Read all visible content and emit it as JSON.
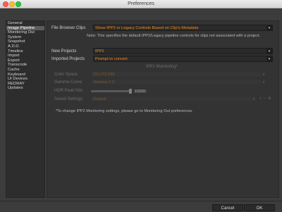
{
  "window": {
    "title": "Preferences"
  },
  "sidebar": {
    "items": [
      {
        "label": "General",
        "selected": false
      },
      {
        "label": "Image Pipeline",
        "selected": true
      },
      {
        "label": "Monitoring Out",
        "selected": false
      },
      {
        "label": "System",
        "selected": false
      },
      {
        "label": "Snapshot",
        "selected": false
      },
      {
        "label": "A.D.D.",
        "selected": false
      },
      {
        "label": "Timeline",
        "selected": false
      },
      {
        "label": "Import",
        "selected": false
      },
      {
        "label": "Export",
        "selected": false
      },
      {
        "label": "Transcode",
        "selected": false
      },
      {
        "label": "Cache",
        "selected": false
      },
      {
        "label": "Keyboard",
        "selected": false
      },
      {
        "label": "UI Devices",
        "selected": false
      },
      {
        "label": "REDRAY",
        "selected": false
      },
      {
        "label": "Updates",
        "selected": false
      }
    ]
  },
  "file_browser_clips": {
    "label": "File Browser Clips",
    "value": "Show IPP2 or Legacy Controls Based on Clip's Metadata",
    "note": "Note: This specifies the default IPP2/Legacy pipeline controls for clips not associated with a project."
  },
  "new_projects": {
    "label": "New Projects",
    "value": "IPP2"
  },
  "imported_projects": {
    "label": "Imported Projects",
    "value": "Prompt to convert"
  },
  "ipp2_monitoring": {
    "heading": "IPP2 Monitoring*",
    "color_space": {
      "label": "Color Space",
      "value": "DCI-P3 D65"
    },
    "gamma_curve": {
      "label": "Gamma Curve",
      "value": "Gamma 2.2"
    },
    "hdr_peak_nits": {
      "label": "HDR Peak Nits",
      "value": "10000",
      "fill": 1.0
    },
    "saved_settings": {
      "label": "Saved Settings",
      "value": "Default"
    },
    "footnote": "*To change IPP2 Monitoring settings, please go to Monitoring Out preferences."
  },
  "footer": {
    "cancel_label": "Cancel",
    "ok_label": "OK"
  }
}
